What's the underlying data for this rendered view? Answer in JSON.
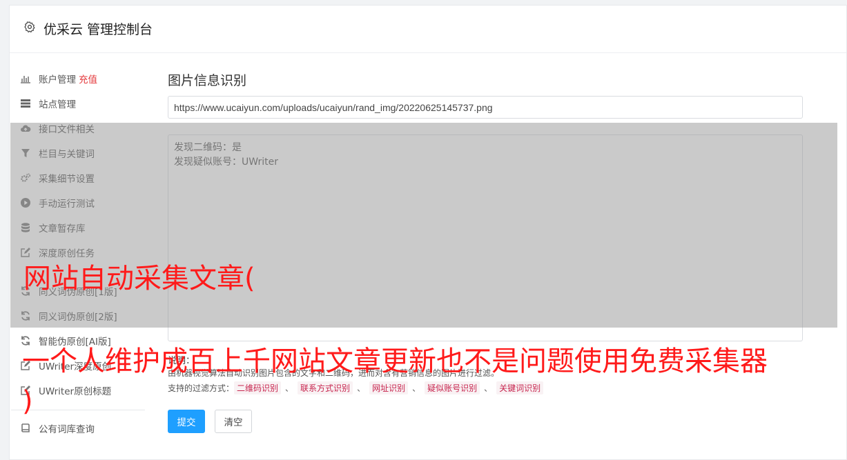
{
  "header": {
    "title": "优采云 管理控制台",
    "icon": "gear-icon"
  },
  "sidebar": {
    "items": [
      {
        "label": "账户管理",
        "extra": "充值",
        "icon": "bar-chart-icon"
      },
      {
        "label": "站点管理",
        "icon": "server-icon"
      },
      {
        "label": "接口文件相关",
        "icon": "cloud-upload-icon"
      },
      {
        "label": "栏目与关键词",
        "icon": "filter-icon"
      },
      {
        "label": "采集细节设置",
        "icon": "cogs-icon"
      },
      {
        "label": "手动运行测试",
        "icon": "play-circle-icon"
      },
      {
        "label": "文章暂存库",
        "icon": "database-icon"
      },
      {
        "label": "深度原创任务",
        "icon": "edit-icon"
      },
      {
        "label": "同义词伪原创[1版]",
        "icon": "refresh-icon"
      },
      {
        "label": "同义词伪原创[2版]",
        "icon": "refresh-icon"
      },
      {
        "label": "智能伪原创[AI版]",
        "icon": "refresh-icon"
      },
      {
        "label": "UWriter深度原创",
        "icon": "edit-icon"
      },
      {
        "label": "UWriter原创标题",
        "icon": "edit-icon"
      }
    ],
    "bottom_item": {
      "label": "公有词库查询",
      "icon": "book-icon"
    }
  },
  "main": {
    "heading": "图片信息识别",
    "url_value": "https://www.ucaiyun.com/uploads/ucaiyun/rand_img/20220625145737.png",
    "result_lines": [
      "发现二维码：是",
      "发现疑似账号：UWriter"
    ],
    "desc_title": "说明：",
    "description": "由机器视觉算法自动识别图片包含的文字和二维码，进而对含有营销信息的图片进行过滤。",
    "filters_label": "支持的过滤方式：",
    "filters": [
      "二维码识别",
      "联系方式识别",
      "网址识别",
      "疑似账号识别",
      "关键词识别"
    ],
    "filter_sep": "、",
    "submit_label": "提交",
    "clear_label": "清空"
  },
  "overlay_captions": {
    "line1": "网站自动采集文章(",
    "line2": "一个人维护成百上千网站文章更新也不是问题使用免费采集器",
    "line3": ")"
  },
  "colors": {
    "accent": "#1e9fff",
    "recharge": "#e4393c",
    "caption": "#ff1a1a",
    "tag": "#c7254e"
  }
}
